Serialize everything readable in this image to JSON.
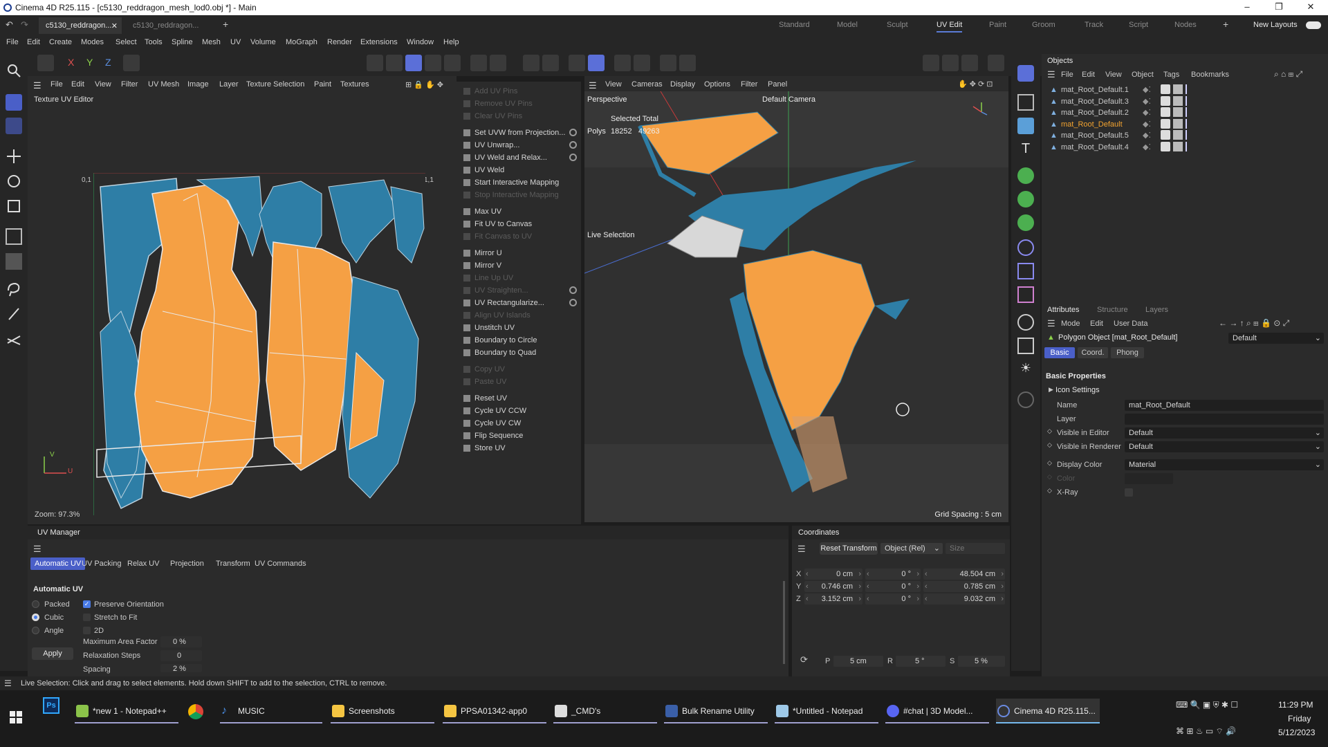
{
  "window": {
    "title": "Cinema 4D R25.115 - [c5130_reddragon_mesh_lod0.obj *] - Main"
  },
  "doc_tabs": [
    "c5130_reddragon...",
    "c5130_reddragon..."
  ],
  "layouts": [
    "Standard",
    "Model",
    "Sculpt",
    "UV Edit",
    "Paint",
    "Groom",
    "Track",
    "Script",
    "Nodes"
  ],
  "active_layout": "UV Edit",
  "new_layouts_label": "New Layouts",
  "main_menu": [
    "File",
    "Edit",
    "Create",
    "Modes",
    "Select",
    "Tools",
    "Spline",
    "Mesh",
    "UV",
    "Volume",
    "MoGraph",
    "Render",
    "Extensions",
    "Window",
    "Help"
  ],
  "uv_editor": {
    "menu": [
      "File",
      "Edit",
      "View",
      "Filter",
      "UV Mesh",
      "Image",
      "Layer",
      "Texture Selection",
      "Paint",
      "Textures"
    ],
    "title": "Texture UV Editor",
    "corner_label_left": "0,1",
    "corner_label_right": "1,1",
    "axis_v": "V",
    "axis_u": "U",
    "zoom": "Zoom: 97.3%"
  },
  "uv_commands": [
    {
      "label": "Add UV Pins",
      "enabled": false
    },
    {
      "label": "Remove UV Pins",
      "enabled": false
    },
    {
      "label": "Clear UV Pins",
      "enabled": false
    },
    {
      "label": "Set UVW from Projection...",
      "enabled": true,
      "gear": true
    },
    {
      "label": "UV Unwrap...",
      "enabled": true,
      "gear": true
    },
    {
      "label": "UV Weld and Relax...",
      "enabled": true,
      "gear": true
    },
    {
      "label": "UV Weld",
      "enabled": true
    },
    {
      "label": "Start Interactive Mapping",
      "enabled": true
    },
    {
      "label": "Stop Interactive Mapping",
      "enabled": false
    },
    {
      "label": "Max UV",
      "enabled": true
    },
    {
      "label": "Fit UV to Canvas",
      "enabled": true
    },
    {
      "label": "Fit Canvas to UV",
      "enabled": false
    },
    {
      "label": "Mirror U",
      "enabled": true
    },
    {
      "label": "Mirror V",
      "enabled": true
    },
    {
      "label": "Line Up UV",
      "enabled": false
    },
    {
      "label": "UV Straighten...",
      "enabled": false,
      "gear": true
    },
    {
      "label": "UV Rectangularize...",
      "enabled": true,
      "gear": true
    },
    {
      "label": "Align UV Islands",
      "enabled": false
    },
    {
      "label": "Unstitch UV",
      "enabled": true
    },
    {
      "label": "Boundary to Circle",
      "enabled": true
    },
    {
      "label": "Boundary to Quad",
      "enabled": true
    },
    {
      "label": "Copy UV",
      "enabled": false
    },
    {
      "label": "Paste UV",
      "enabled": false
    },
    {
      "label": "Reset UV",
      "enabled": true
    },
    {
      "label": "Cycle UV CCW",
      "enabled": true
    },
    {
      "label": "Cycle UV CW",
      "enabled": true
    },
    {
      "label": "Flip Sequence",
      "enabled": true
    },
    {
      "label": "Store UV",
      "enabled": true
    }
  ],
  "viewport": {
    "menu": [
      "View",
      "Cameras",
      "Display",
      "Options",
      "Filter",
      "Panel"
    ],
    "name": "Perspective",
    "camera": "Default Camera",
    "stats_header": "Selected Total",
    "stats_label": "Polys",
    "stats_selected": "18252",
    "stats_total": "49263",
    "live_selection": "Live Selection",
    "grid_spacing": "Grid Spacing : 5 cm"
  },
  "objects": {
    "tab": "Objects",
    "menu": [
      "File",
      "Edit",
      "View",
      "Object",
      "Tags",
      "Bookmarks"
    ],
    "items": [
      {
        "name": "mat_Root_Default.1",
        "selected": false
      },
      {
        "name": "mat_Root_Default.3",
        "selected": false
      },
      {
        "name": "mat_Root_Default.2",
        "selected": false
      },
      {
        "name": "mat_Root_Default",
        "selected": true
      },
      {
        "name": "mat_Root_Default.5",
        "selected": false
      },
      {
        "name": "mat_Root_Default.4",
        "selected": false
      }
    ]
  },
  "attributes": {
    "tabs": [
      "Attributes",
      "Structure",
      "Layers"
    ],
    "menu": [
      "Mode",
      "Edit",
      "User Data"
    ],
    "object_title": "Polygon Object [mat_Root_Default]",
    "preset": "Default",
    "subtabs": [
      "Basic",
      "Coord.",
      "Phong"
    ],
    "section": "Basic Properties",
    "icon_settings": "Icon Settings",
    "fields": [
      {
        "label": "Name",
        "value": "mat_Root_Default"
      },
      {
        "label": "Layer",
        "value": ""
      },
      {
        "label": "Visible in Editor",
        "value": "Default"
      },
      {
        "label": "Visible in Renderer",
        "value": "Default"
      },
      {
        "label": "Display Color",
        "value": "Material"
      },
      {
        "label": "Color",
        "value": ""
      },
      {
        "label": "X-Ray",
        "value": ""
      }
    ]
  },
  "uv_manager": {
    "title": "UV Manager",
    "tabs": [
      "Automatic UV",
      "UV Packing",
      "Relax UV",
      "Projection",
      "Transform",
      "UV Commands"
    ],
    "section": "Automatic UV",
    "radios": [
      {
        "label": "Packed",
        "checked": false
      },
      {
        "label": "Cubic",
        "checked": true
      },
      {
        "label": "Angle",
        "checked": false
      }
    ],
    "checks": [
      {
        "label": "Preserve Orientation",
        "checked": true
      },
      {
        "label": "Stretch to Fit",
        "checked": false
      },
      {
        "label": "2D",
        "checked": false
      }
    ],
    "max_area_label": "Maximum Area Factor",
    "max_area_value": "0 %",
    "relax_label": "Relaxation Steps",
    "relax_value": "0",
    "spacing_label": "Spacing",
    "spacing_value": "2 %",
    "apply": "Apply"
  },
  "coordinates": {
    "title": "Coordinates",
    "reset": "Reset Transform",
    "mode": "Object (Rel)",
    "size": "Size",
    "rows": [
      {
        "axis": "X",
        "pos": "0 cm",
        "rot": "0 °",
        "size": "48.504 cm"
      },
      {
        "axis": "Y",
        "pos": "0.746 cm",
        "rot": "0 °",
        "size": "0.785 cm"
      },
      {
        "axis": "Z",
        "pos": "3.152 cm",
        "rot": "0 °",
        "size": "9.032 cm"
      }
    ],
    "bottom": {
      "p_label": "P",
      "p": "5 cm",
      "r_label": "R",
      "r": "5 °",
      "s_label": "S",
      "s": "5 %"
    }
  },
  "status": "Live Selection: Click and drag to select elements. Hold down SHIFT to add to the selection, CTRL to remove.",
  "taskbar": {
    "items": [
      "*new 1 - Notepad++",
      "MUSIC",
      "Screenshots",
      "PPSA01342-app0",
      "_CMD's",
      "Bulk Rename Utility",
      "*Untitled - Notepad",
      "#chat | 3D Model...",
      "Cinema 4D R25.115..."
    ],
    "time": "11:29 PM",
    "day": "Friday",
    "date": "5/12/2023"
  },
  "colors": {
    "accent": "#5b7cd6",
    "uv_orange": "#f5a044",
    "uv_blue": "#2e7ea6",
    "selected_object": "#f2a330"
  }
}
